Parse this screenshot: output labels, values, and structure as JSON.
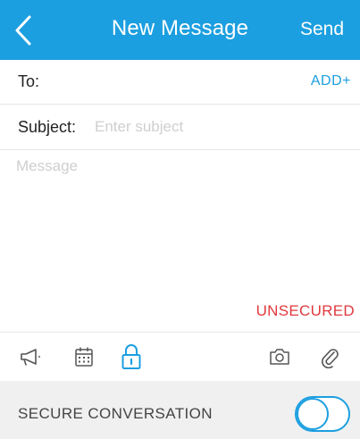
{
  "header": {
    "title": "New Message",
    "send_label": "Send",
    "back_icon": "chevron-left-icon"
  },
  "to": {
    "label": "To:",
    "add_label": "ADD+"
  },
  "subject": {
    "label": "Subject:",
    "placeholder": "Enter subject",
    "value": ""
  },
  "message": {
    "placeholder": "Message",
    "value": ""
  },
  "security_status": "UNSECURED",
  "toolbar": {
    "icons": [
      "megaphone-icon",
      "calendar-icon",
      "lock-icon",
      "camera-icon",
      "paperclip-icon"
    ]
  },
  "secure_conversation": {
    "label": "SECURE CONVERSATION",
    "enabled": false
  },
  "colors": {
    "accent": "#1c9fe0",
    "warning": "#e0393e",
    "placeholder": "#cfcfcf",
    "footer_bg": "#f0f0f0"
  }
}
